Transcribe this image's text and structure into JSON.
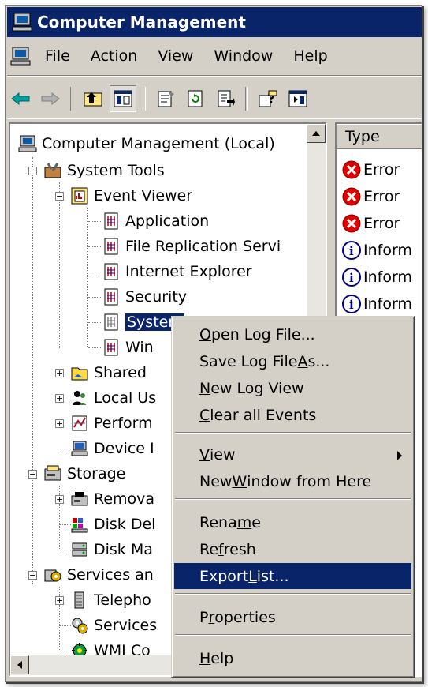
{
  "window": {
    "title": "Computer Management"
  },
  "menu": [
    {
      "pre": "",
      "ul": "F",
      "post": "ile"
    },
    {
      "pre": "",
      "ul": "A",
      "post": "ction"
    },
    {
      "pre": "",
      "ul": "V",
      "post": "iew"
    },
    {
      "pre": "",
      "ul": "W",
      "post": "indow"
    },
    {
      "pre": "",
      "ul": "H",
      "post": "elp"
    }
  ],
  "tree": {
    "root": "Computer Management (Local)",
    "system_tools": "System Tools",
    "event_viewer": "Event Viewer",
    "logs": [
      "Application",
      "File Replication Servi",
      "Internet Explorer",
      "Security",
      "System",
      "Win"
    ],
    "shared": "Shared",
    "local_users": "Local Us",
    "performance": "Perform",
    "device_manager": "Device I",
    "storage": "Storage",
    "removable": "Remova",
    "disk_defrag": "Disk Del",
    "disk_mgmt": "Disk Ma",
    "services_apps": "Services an",
    "telephony": "Telepho",
    "services": "Services",
    "wmi": "WMI Co"
  },
  "list": {
    "column": "Type",
    "rows": [
      {
        "type": "error",
        "label": "Error"
      },
      {
        "type": "error",
        "label": "Error"
      },
      {
        "type": "error",
        "label": "Error"
      },
      {
        "type": "info",
        "label": "Inform"
      },
      {
        "type": "info",
        "label": "Inform"
      },
      {
        "type": "info",
        "label": "Inform"
      }
    ]
  },
  "context_menu": {
    "open_log": {
      "pre": "",
      "ul": "O",
      "post": "pen Log File..."
    },
    "save_log": {
      "pre": "Save Log File ",
      "ul": "A",
      "post": "s..."
    },
    "new_log_view": {
      "pre": "",
      "ul": "N",
      "post": "ew Log View"
    },
    "clear_events": {
      "pre": "",
      "ul": "C",
      "post": "lear all Events"
    },
    "view": {
      "pre": "",
      "ul": "V",
      "post": "iew"
    },
    "new_window": {
      "pre": "New ",
      "ul": "W",
      "post": "indow from Here"
    },
    "rename": {
      "pre": "Rena",
      "ul": "m",
      "post": "e"
    },
    "refresh": {
      "pre": "Re",
      "ul": "f",
      "post": "resh"
    },
    "export": {
      "pre": "Export ",
      "ul": "L",
      "post": "ist..."
    },
    "properties": {
      "pre": "P",
      "ul": "r",
      "post": "operties"
    },
    "help": {
      "pre": "",
      "ul": "H",
      "post": "elp"
    }
  },
  "colors": {
    "titlebar": "#0a246a",
    "selection": "#0a246a",
    "face": "#d4d0c8"
  }
}
